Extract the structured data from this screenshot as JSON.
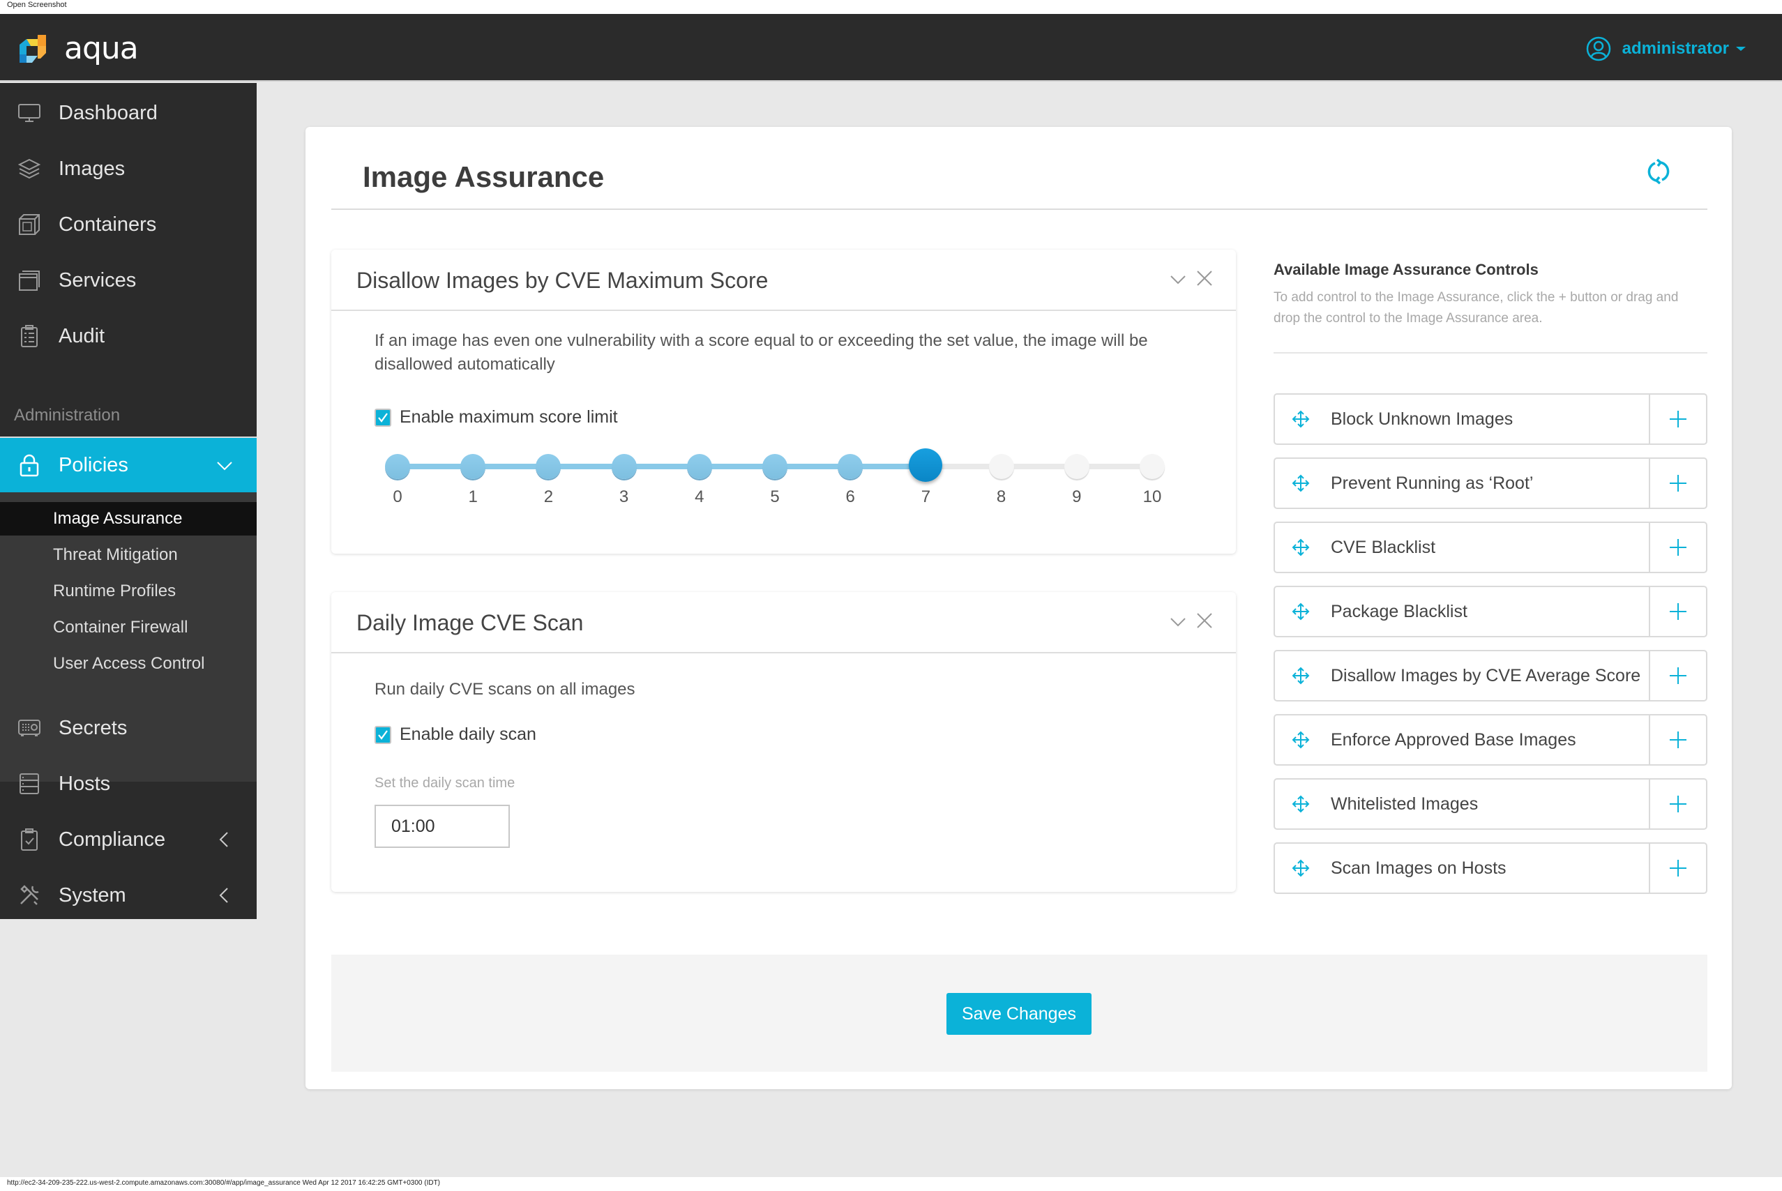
{
  "os_strip": {
    "label": "Open Screenshot"
  },
  "topbar": {
    "brand": "aqua",
    "user": {
      "name": "administrator",
      "icon": "user-circle-icon"
    },
    "colors": {
      "bg": "#2b2b2b",
      "accent": "#0bb2d8"
    }
  },
  "sidebar": {
    "items": [
      {
        "label": "Dashboard",
        "icon": "monitor-icon"
      },
      {
        "label": "Images",
        "icon": "layers-icon"
      },
      {
        "label": "Containers",
        "icon": "box-icon"
      },
      {
        "label": "Services",
        "icon": "windows-icon"
      },
      {
        "label": "Audit",
        "icon": "clipboard-list-icon"
      }
    ],
    "section_label": "Administration",
    "policies": {
      "label": "Policies",
      "icon": "lock-icon",
      "expanded": true
    },
    "sub_items": [
      {
        "label": "Image Assurance",
        "active": true
      },
      {
        "label": "Threat Mitigation",
        "active": false
      },
      {
        "label": "Runtime Profiles",
        "active": false
      },
      {
        "label": "Container Firewall",
        "active": false
      },
      {
        "label": "User Access Control",
        "active": false
      }
    ],
    "lower_items": [
      {
        "label": "Secrets",
        "icon": "safe-icon"
      },
      {
        "label": "Hosts",
        "icon": "server-icon"
      },
      {
        "label": "Compliance",
        "icon": "clipboard-check-icon",
        "has_children": true
      },
      {
        "label": "System",
        "icon": "tools-icon",
        "has_children": true
      }
    ]
  },
  "main": {
    "title": "Image Assurance",
    "refresh_icon": "refresh-icon",
    "panels": [
      {
        "title": "Disallow Images by CVE Maximum Score",
        "description": "If an image has even one vulnerability with a score equal to or exceeding the set value, the image will be disallowed automatically",
        "checkbox": {
          "label": "Enable maximum score limit",
          "checked": true
        },
        "slider": {
          "min": 0,
          "max": 10,
          "step": 1,
          "value": 7,
          "ticks": [
            "0",
            "1",
            "2",
            "3",
            "4",
            "5",
            "6",
            "7",
            "8",
            "9",
            "10"
          ]
        }
      },
      {
        "title": "Daily Image CVE Scan",
        "description": "Run daily CVE scans on all images",
        "checkbox": {
          "label": "Enable daily scan",
          "checked": true
        },
        "time_label": "Set the daily scan time",
        "time_value": "01:00"
      }
    ],
    "controls": {
      "title": "Available Image Assurance Controls",
      "help": "To add control to the Image Assurance, click the + button or drag and drop the control to the Image Assurance area.",
      "items": [
        "Block Unknown Images",
        "Prevent Running as ‘Root’",
        "CVE Blacklist",
        "Package Blacklist",
        "Disallow Images by CVE Average Score",
        "Enforce Approved Base Images",
        "Whitelisted Images",
        "Scan Images on Hosts"
      ]
    },
    "save_label": "Save Changes"
  },
  "statusbar": {
    "text": "http://ec2-34-209-235-222.us-west-2.compute.amazonaws.com:30080/#/app/image_assurance Wed Apr 12 2017 16:42:25 GMT+0300 (IDT)"
  }
}
